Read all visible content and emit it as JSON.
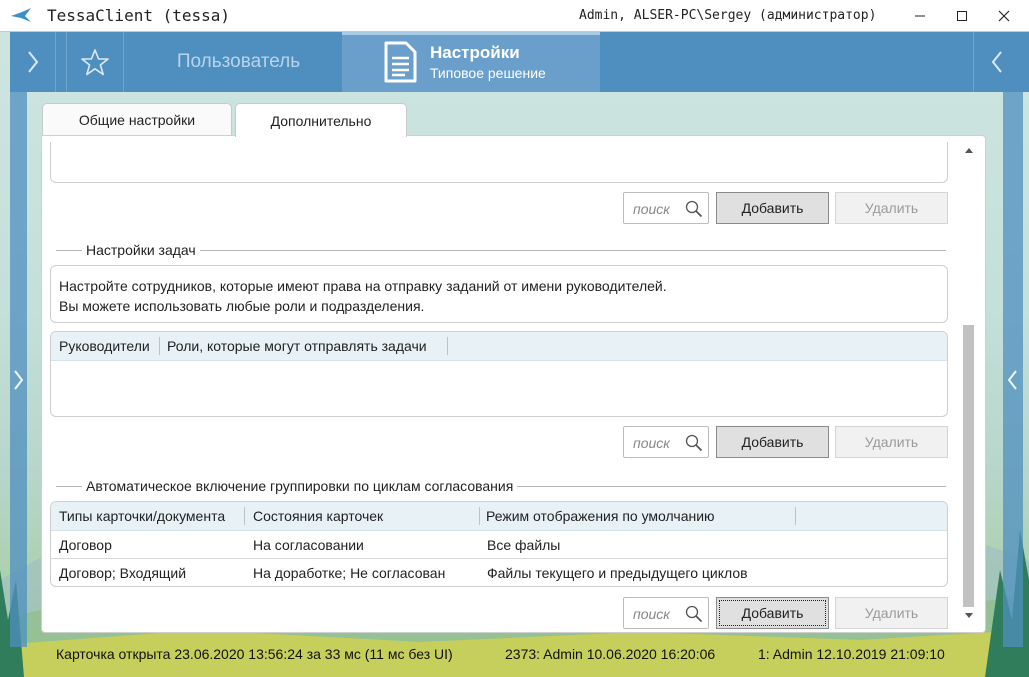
{
  "window": {
    "title": "TessaClient (tessa)",
    "user_info": "Admin, ALSER-PC\\Sergey (администратор)"
  },
  "tabs": {
    "user_tab": "Пользователь",
    "settings_tab_title": "Настройки",
    "settings_tab_subtitle": "Типовое решение"
  },
  "subtabs": [
    "Общие настройки",
    "Дополнительно"
  ],
  "controls": {
    "search_placeholder": "поиск",
    "add_label": "Добавить",
    "delete_label": "Удалить"
  },
  "task_settings": {
    "title": "Настройки задач",
    "info_line1": "Настройте сотрудников, которые имеют права на отправку заданий от имени руководителей.",
    "info_line2": "Вы можете использовать любые роли и подразделения.",
    "columns": [
      "Руководители",
      "Роли, которые могут отправлять задачи"
    ]
  },
  "grouping": {
    "title": "Автоматическое включение группировки по циклам согласования",
    "columns": [
      "Типы карточки/документа",
      "Состояния карточек",
      "Режим отображения по умолчанию"
    ],
    "rows": [
      [
        "Договор",
        "На согласовании",
        "Все файлы"
      ],
      [
        "Договор; Входящий",
        "На доработке; Не согласован",
        "Файлы текущего и предыдущего циклов"
      ]
    ]
  },
  "status": {
    "card_opened": "Карточка открыта 23.06.2020 13:56:24 за 33 мс (11 мс без UI)",
    "version": "2373:  Admin  10.06.2020 16:20:06",
    "created": "1:  Admin  12.10.2019 21:09:10"
  },
  "colors": {
    "accent": "#4f8fc0",
    "tab_active": "#6a9fcc",
    "grid_header": "#e8f1f6"
  }
}
